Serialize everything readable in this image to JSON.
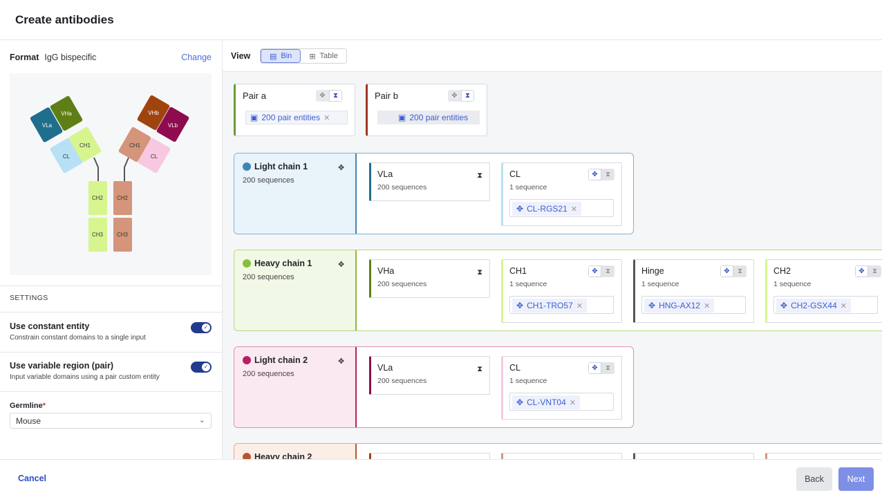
{
  "header": {
    "title": "Create antibodies"
  },
  "left": {
    "format_label": "Format",
    "format_value": "IgG bispecific",
    "change_label": "Change",
    "diagram": {
      "VLa": "VLa",
      "VHa": "VHa",
      "CH1": "CH1",
      "CL": "CL",
      "VHb": "VHb",
      "VLb": "VLb",
      "CH2": "CH2",
      "CH3": "CH3"
    },
    "settings_title": "SETTINGS",
    "setting1": {
      "title": "Use constant entity",
      "desc": "Constrain constant domains to a single input"
    },
    "setting2": {
      "title": "Use variable region (pair)",
      "desc": "Input variable domains using a pair custom entity"
    },
    "germline_label": "Germline",
    "germline_value": "Mouse"
  },
  "view": {
    "label": "View",
    "bin": "Bin",
    "table": "Table"
  },
  "pairs": [
    {
      "title": "Pair a",
      "chip": "200 pair entities"
    },
    {
      "title": "Pair b",
      "chip": "200 pair entities"
    }
  ],
  "groups": {
    "lc1": {
      "name": "Light chain 1",
      "count": "200 sequences",
      "d1": {
        "name": "VLa",
        "count": "200 sequences"
      },
      "d2": {
        "name": "CL",
        "count": "1 sequence",
        "chip": "CL-RGS21"
      }
    },
    "hc1": {
      "name": "Heavy chain 1",
      "count": "200 sequences",
      "d1": {
        "name": "VHa",
        "count": "200 sequences"
      },
      "d2": {
        "name": "CH1",
        "count": "1 sequence",
        "chip": "CH1-TRO57"
      },
      "d3": {
        "name": "Hinge",
        "count": "1 sequence",
        "chip": "HNG-AX12"
      },
      "d4": {
        "name": "CH2",
        "count": "1 sequence",
        "chip": "CH2-GSX44"
      }
    },
    "lc2": {
      "name": "Light chain 2",
      "count": "200 sequences",
      "d1": {
        "name": "VLa",
        "count": "200 sequences"
      },
      "d2": {
        "name": "CL",
        "count": "1 sequence",
        "chip": "CL-VNT04"
      }
    },
    "hc2": {
      "name": "Heavy chain 2"
    }
  },
  "footer": {
    "cancel": "Cancel",
    "back": "Back",
    "next": "Next"
  },
  "colors": {
    "accent": "#3b5bd0",
    "lc1": "#3f86b8",
    "hc1": "#8bbd3c",
    "lc2": "#b5215f",
    "hc2": "#b8552e"
  }
}
